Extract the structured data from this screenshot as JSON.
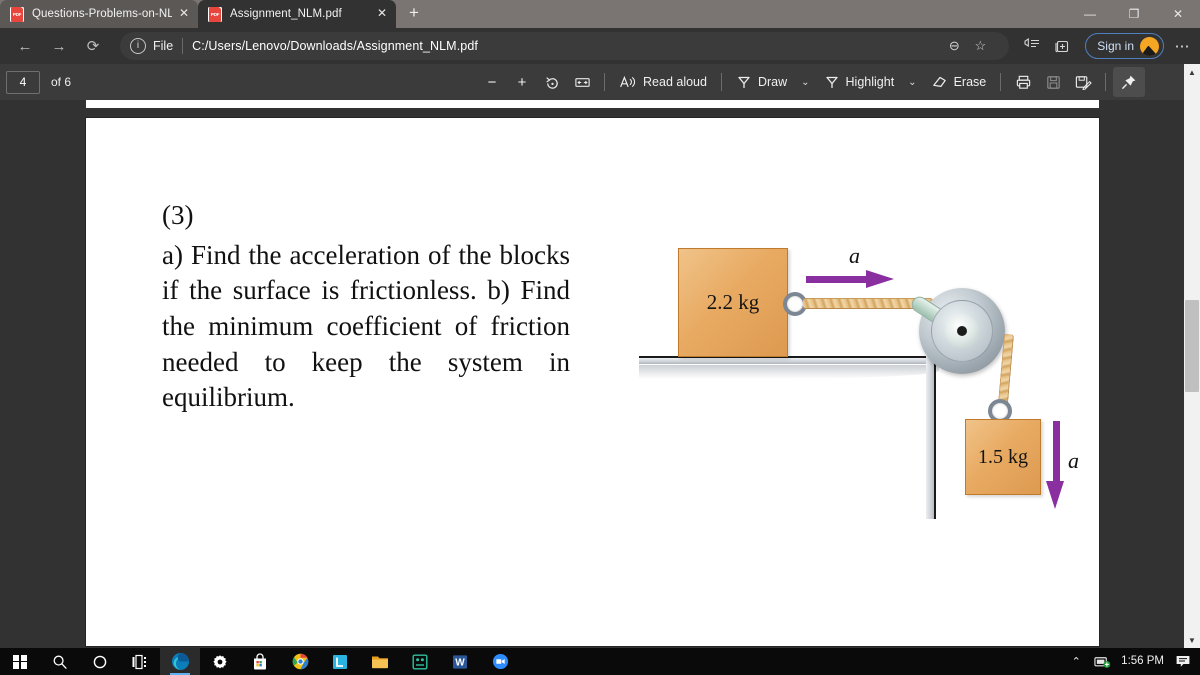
{
  "browser": {
    "tabs": [
      {
        "title": "Questions-Problems-on-NLM.pdf",
        "favicon": "pdf-icon",
        "close": "✕",
        "active": false
      },
      {
        "title": "Assignment_NLM.pdf",
        "favicon": "pdf-icon",
        "close": "✕",
        "active": true
      }
    ],
    "new_tab_label": "+",
    "window_controls": {
      "minimize": "—",
      "maximize": "❐",
      "close": "✕"
    },
    "nav": {
      "back": "←",
      "forward": "→",
      "reload": "⟳"
    },
    "omnibox": {
      "info_icon": "ⓘ",
      "scheme_label": "File",
      "url": "C:/Users/Lenovo/Downloads/Assignment_NLM.pdf",
      "zoom_out_icon": "⊖",
      "favorite_icon": "☆"
    },
    "toolbar": {
      "collections_icon": "☰",
      "favorites_bar_icon": "☰",
      "sign_in_label": "Sign in",
      "more_label": "⋯"
    }
  },
  "pdf_toolbar": {
    "page_number": "4",
    "page_total": "of 6",
    "zoom_out": "−",
    "zoom_in": "+",
    "rotate": "↻",
    "fit_page": "▭",
    "read_aloud": "Read aloud",
    "draw": "Draw",
    "draw_caret": "⌄",
    "highlight": "Highlight",
    "highlight_caret": "⌄",
    "erase": "Erase",
    "print": "⎙",
    "save": "Ὃe",
    "save_as": "⎘",
    "pin": "Ὄc"
  },
  "document": {
    "question_number": "(3)",
    "question_body": "a) Find the acceleration of the blocks if the surface is frictionless. b) Find the minimum coefficient of friction needed to keep the system in equilibrium.",
    "figure": {
      "block_top_label": "2.2 kg",
      "block_hanging_label": "1.5 kg",
      "accel_label_horizontal": "a",
      "accel_label_vertical": "a",
      "accent_arrow_color": "#8a2fa0",
      "block_color": "#e8aa62",
      "rope_color": "#e8c287",
      "pulley_color": "#aeb8bf",
      "surface_color": "#cfd4d9"
    }
  },
  "scrollbar": {
    "up_arrow": "▲",
    "down_arrow": "▼"
  },
  "taskbar": {
    "items": [
      {
        "name": "start",
        "glyph": ""
      },
      {
        "name": "search",
        "glyph": "⌕"
      },
      {
        "name": "cortana",
        "glyph": "◯"
      },
      {
        "name": "task-view",
        "glyph": "☰"
      },
      {
        "name": "edge",
        "glyph": "e"
      },
      {
        "name": "settings",
        "glyph": "⚙"
      },
      {
        "name": "microsoft-store",
        "glyph": "Ὤd"
      },
      {
        "name": "chrome",
        "glyph": "◉"
      },
      {
        "name": "lightshot",
        "glyph": "L"
      },
      {
        "name": "file-explorer",
        "glyph": "Ὄ1"
      },
      {
        "name": "app",
        "glyph": "▦"
      },
      {
        "name": "word",
        "glyph": "W"
      },
      {
        "name": "zoom",
        "glyph": "▶"
      }
    ],
    "tray": {
      "show_hidden": "⌃",
      "network": "὚7",
      "clock": "1:56 PM",
      "notifications": "὚8"
    }
  }
}
